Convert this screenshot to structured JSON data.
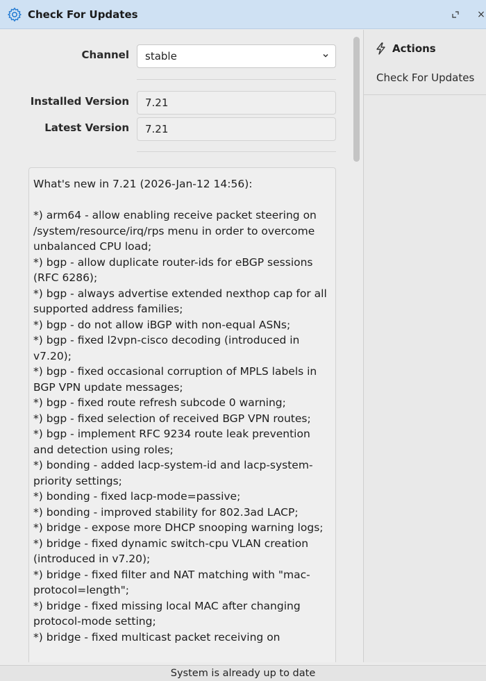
{
  "window": {
    "title": "Check For Updates",
    "icon": "gear-icon",
    "restore_icon": "restore-icon",
    "close_label": "×"
  },
  "form": {
    "channel_label": "Channel",
    "channel_value": "stable",
    "installed_label": "Installed Version",
    "installed_value": "7.21",
    "latest_label": "Latest Version",
    "latest_value": "7.21"
  },
  "changelog": {
    "text": "What's new in 7.21 (2026-Jan-12 14:56):\n\n*) arm64 - allow enabling receive packet steering on /system/resource/irq/rps menu in order to overcome unbalanced CPU load;\n*) bgp - allow duplicate router-ids for eBGP sessions (RFC 6286);\n*) bgp - always advertise extended nexthop cap for all supported address families;\n*) bgp - do not allow iBGP with non-equal ASNs;\n*) bgp - fixed l2vpn-cisco decoding (introduced in v7.20);\n*) bgp - fixed occasional corruption of MPLS labels in BGP VPN update messages;\n*) bgp - fixed route refresh subcode 0 warning;\n*) bgp - fixed selection of received BGP VPN routes;\n*) bgp - implement RFC 9234 route leak prevention and detection using roles;\n*) bonding - added lacp-system-id and lacp-system-priority settings;\n*) bonding - fixed lacp-mode=passive;\n*) bonding - improved stability for 802.3ad LACP;\n*) bridge - expose more DHCP snooping warning logs;\n*) bridge - fixed dynamic switch-cpu VLAN creation (introduced in v7.20);\n*) bridge - fixed filter and NAT matching with \"mac-protocol=length\";\n*) bridge - fixed missing local MAC after changing protocol-mode setting;\n*) bridge - fixed multicast packet receiving on"
  },
  "actions": {
    "header": "Actions",
    "icon": "lightning-icon",
    "items": [
      "Check For Updates"
    ]
  },
  "status": {
    "text": "System is already up to date"
  },
  "colors": {
    "titlebar": "#cfe1f3",
    "accent": "#2a7fd4"
  }
}
